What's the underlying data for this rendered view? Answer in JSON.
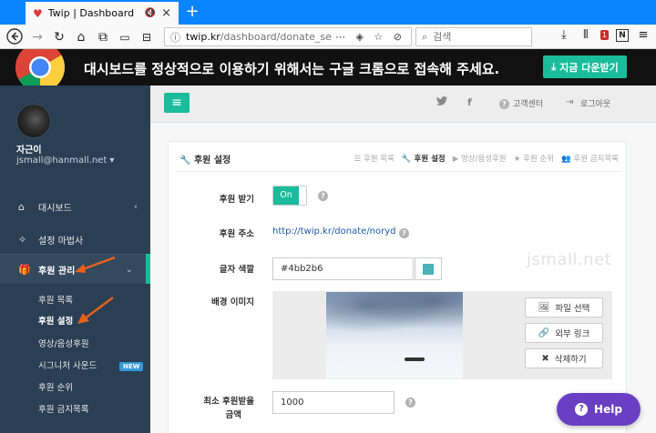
{
  "browser": {
    "tab_title": "Twip | Dashboard",
    "url_host": "twip.kr",
    "url_path": "/dashboard/donate_se",
    "search_placeholder": "검색",
    "notification_count": "1"
  },
  "banner": {
    "text": "대시보드를 정상적으로 이용하기 위해서는 구글 크롬으로 접속해 주세요.",
    "download_label": "지금 다운받기"
  },
  "sidebar": {
    "user_name": "자근이",
    "user_email": "jsmall@hanmall.net",
    "menu": [
      {
        "label": "대시보드"
      },
      {
        "label": "설정 마법사"
      },
      {
        "label": "후원 관리"
      }
    ],
    "submenu": [
      {
        "label": "후원 목록"
      },
      {
        "label": "후원 설정"
      },
      {
        "label": "영상/음성후원"
      },
      {
        "label": "시그니처 사운드"
      },
      {
        "label": "후원 순위"
      },
      {
        "label": "후원 금지목록"
      }
    ],
    "new_badge": "NEW"
  },
  "topnav": {
    "support_label": "고객센터",
    "logout_label": "로그아웃"
  },
  "panel": {
    "title": "후원 설정",
    "tabs": [
      "후원 목록",
      "후원 설정",
      "영상/음성후원",
      "후원 순위",
      "후원 금지목록"
    ]
  },
  "form": {
    "receive_label": "후원 받기",
    "receive_state": "On",
    "address_label": "후원 주소",
    "address_value": "http://twip.kr/donate/noryd",
    "color_label": "글자 색깔",
    "color_value": "#4bb2b6",
    "bg_label": "배경 이미지",
    "file_select": "파일 선택",
    "external_link": "외부 링크",
    "delete": "삭제하기",
    "min_label_1": "최소 후원받을",
    "min_label_2": "금액",
    "min_value": "1000"
  },
  "watermark": "jsmall.net",
  "help_label": "Help",
  "colors": {
    "accent": "#1abc9c",
    "sidebar": "#2a3f54",
    "help": "#6a3fc4",
    "arrow": "#e8611a"
  },
  "icons": [
    "heart-icon",
    "mute-icon",
    "close-icon",
    "back-icon",
    "forward-icon",
    "reload-icon",
    "home-icon",
    "info-icon",
    "download-icon",
    "library-icon",
    "sidebar-toggle-icon",
    "home-icon",
    "wand-icon",
    "gift-icon",
    "bars-icon",
    "twitter-icon",
    "facebook-icon",
    "question-icon",
    "logout-icon",
    "wrench-icon",
    "image-icon",
    "link-icon",
    "times-icon"
  ]
}
